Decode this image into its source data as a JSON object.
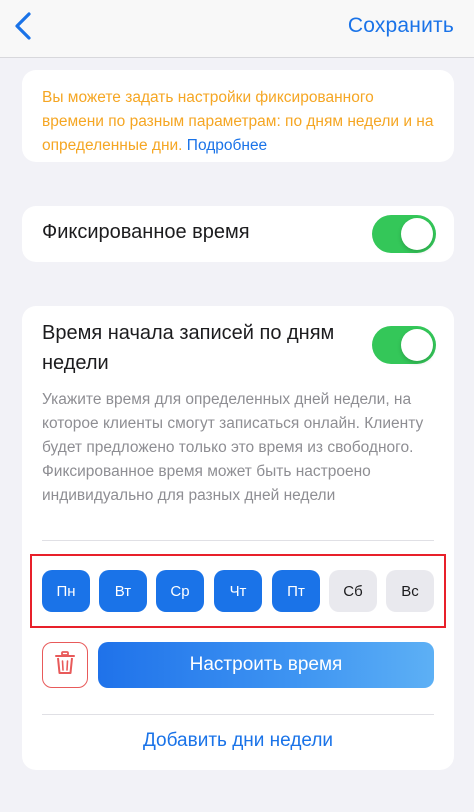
{
  "navbar": {
    "back_icon": "chevron-left-icon",
    "save_label": "Сохранить"
  },
  "info": {
    "text": "Вы можете задать настройки фиксированного времени по разным параметрам: по дням недели и на определенные дни.",
    "link": "Подробнее"
  },
  "fixed_time": {
    "label": "Фиксированное время",
    "enabled": true
  },
  "weekday_start": {
    "title": "Время начала записей по дням недели",
    "enabled": true,
    "description": "Укажите время для определенных дней недели, на которое клиенты смогут записаться онлайн. Клиенту будет предложено только это время из свободного. Фиксированное время может быть настроено индивидуально для разных дней недели",
    "days": [
      {
        "label": "Пн",
        "selected": true
      },
      {
        "label": "Вт",
        "selected": true
      },
      {
        "label": "Ср",
        "selected": true
      },
      {
        "label": "Чт",
        "selected": true
      },
      {
        "label": "Пт",
        "selected": true
      },
      {
        "label": "Сб",
        "selected": false
      },
      {
        "label": "Вс",
        "selected": false
      }
    ],
    "delete_icon": "trash-icon",
    "setup_label": "Настроить время",
    "add_days_label": "Добавить дни недели"
  },
  "colors": {
    "accent": "#1a73e8",
    "toggle_on": "#34c759",
    "warning_text": "#f5a623",
    "highlight_border": "#e8202a"
  }
}
